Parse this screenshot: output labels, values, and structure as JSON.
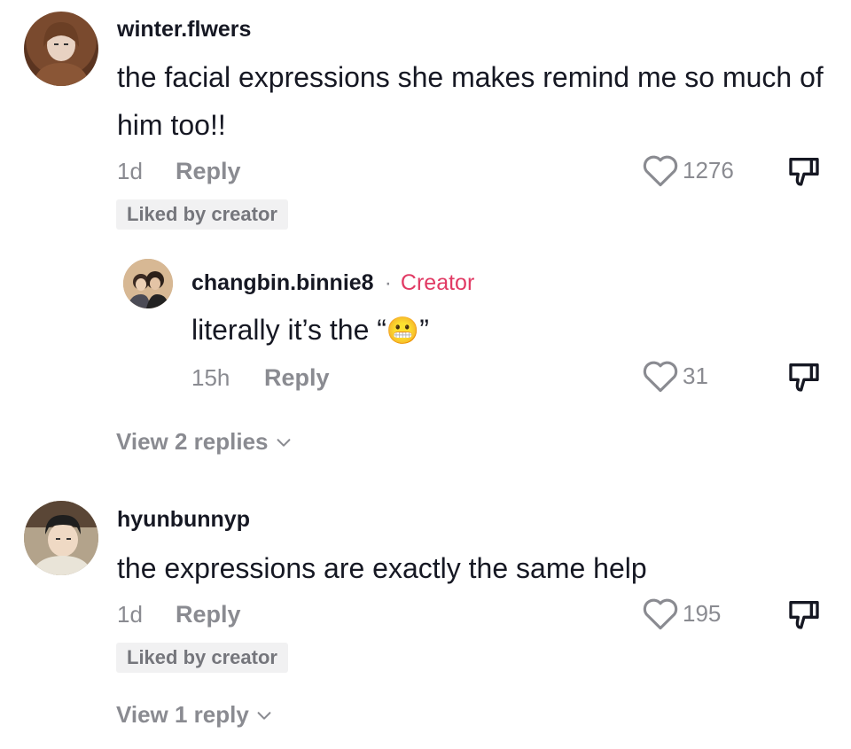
{
  "comments": [
    {
      "username": "winter.flwers",
      "text": "the facial expressions she makes remind me so much of him too!!",
      "time": "1d",
      "reply_label": "Reply",
      "likes": "1276",
      "badge": "Liked by creator",
      "view_replies": "View 2 replies",
      "avatar_icon": "avatar-photo",
      "reply": {
        "username": "changbin.binnie8",
        "separator": "·",
        "creator_label": "Creator",
        "text_before": "literally it’s the “",
        "emoji": "😬",
        "text_after": "”",
        "time": "15h",
        "reply_label": "Reply",
        "likes": "31"
      }
    },
    {
      "username": "hyunbunnyp",
      "text": "the expressions are exactly the same help",
      "time": "1d",
      "reply_label": "Reply",
      "likes": "195",
      "badge": "Liked by creator",
      "view_replies": "View 1 reply"
    }
  ],
  "icons": {
    "like": "heart-outline-icon",
    "dislike": "thumbs-down-icon",
    "expand": "chevron-down-icon"
  },
  "colors": {
    "creator": "#e13a64",
    "secondary_text": "#8a8b91",
    "primary_text": "#161823",
    "badge_bg": "#f1f1f2"
  }
}
